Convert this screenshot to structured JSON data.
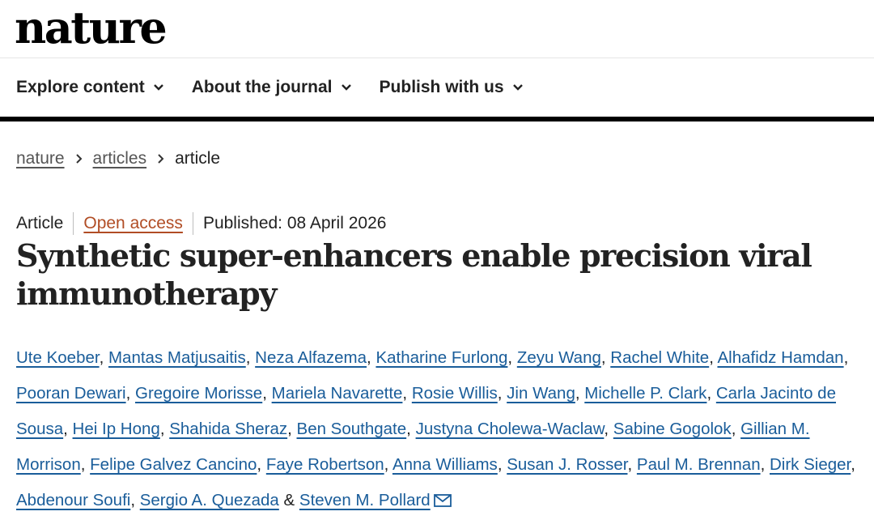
{
  "site": {
    "logo": "nature"
  },
  "nav": {
    "items": [
      {
        "label": "Explore content"
      },
      {
        "label": "About the journal"
      },
      {
        "label": "Publish with us"
      }
    ]
  },
  "breadcrumb": {
    "root": "nature",
    "section": "articles",
    "current": "article"
  },
  "article": {
    "type": "Article",
    "access": "Open access",
    "published": "Published: 08 April 2026",
    "title": "Synthetic super-enhancers enable precision viral immunotherapy",
    "authors": [
      "Ute Koeber",
      "Mantas Matjusaitis",
      "Neza Alfazema",
      "Katharine Furlong",
      "Zeyu Wang",
      "Rachel White",
      "Alhafidz Hamdan",
      "Pooran Dewari",
      "Gregoire Morisse",
      "Mariela Navarette",
      "Rosie Willis",
      "Jin Wang",
      "Michelle P. Clark",
      "Carla Jacinto de Sousa",
      "Hei Ip Hong",
      "Shahida Sheraz",
      "Ben Southgate",
      "Justyna Cholewa-Waclaw",
      "Sabine Gogolok",
      "Gillian M. Morrison",
      "Felipe Galvez Cancino",
      "Faye Robertson",
      "Anna Williams",
      "Susan J. Rosser",
      "Paul M. Brennan",
      "Dirk Sieger",
      "Abdenour Soufi",
      "Sergio A. Quezada",
      "Steven M. Pollard"
    ],
    "author_separator": ", ",
    "last_author_joiner": " & ",
    "corresponding_icon": "mail-icon"
  },
  "colors": {
    "link": "#1a5d9a",
    "open_access": "#b14d25",
    "nav_rule": "#000000"
  }
}
